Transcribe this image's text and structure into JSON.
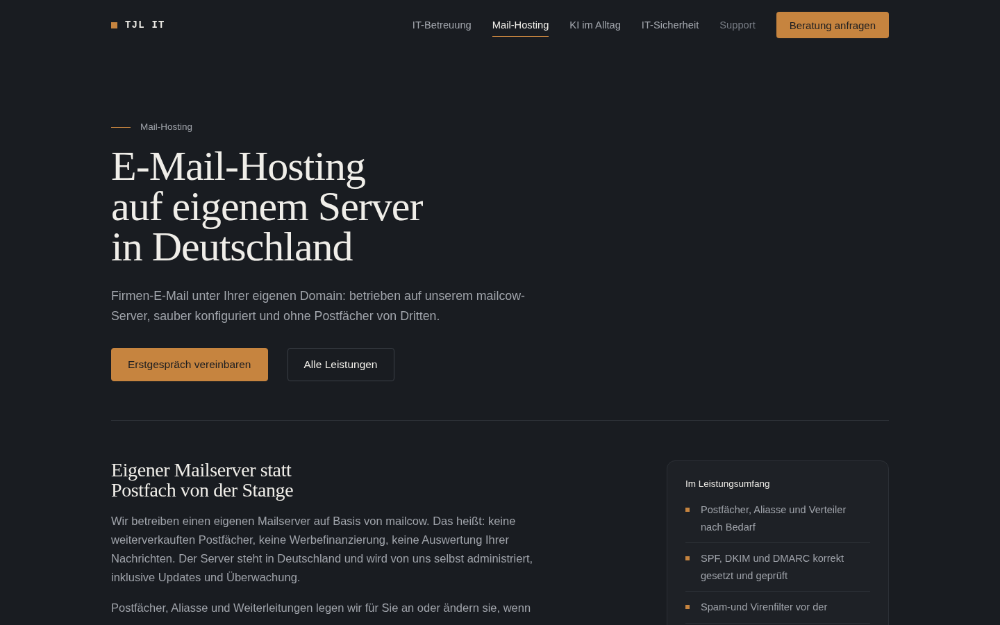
{
  "header": {
    "logo": "TJL IT",
    "nav": [
      {
        "label": "IT-Betreuung",
        "selected": false,
        "muted": false
      },
      {
        "label": "Mail-Hosting",
        "selected": true,
        "muted": false
      },
      {
        "label": "KI im Alltag",
        "selected": false,
        "muted": false
      },
      {
        "label": "IT-Sicherheit",
        "selected": false,
        "muted": false
      },
      {
        "label": "Support",
        "selected": false,
        "muted": true
      }
    ],
    "cta": "Beratung anfragen"
  },
  "hero": {
    "eyebrow": "Mail-Hosting",
    "title": [
      "E-Mail-Hosting",
      "auf eigenem Server",
      "in Deutschland"
    ],
    "lead": "Firmen-E-Mail unter Ihrer eigenen Domain: betrieben auf unserem mailcow-Server, sauber konfiguriert und ohne Postfächer von Dritten.",
    "buttons": [
      {
        "label": "Erstgespräch vereinbaren",
        "kind": "primary"
      },
      {
        "label": "Alle Leistungen",
        "kind": "secondary"
      }
    ]
  },
  "section": {
    "heading": [
      "Eigener Mailserver statt",
      "Postfach von der Stange"
    ],
    "paragraphs": [
      "Wir betreiben einen eigenen Mailserver auf Basis von mailcow. Das heißt: keine weiterverkauften Postfächer, keine Werbefinanzierung, keine Auswertung Ihrer Nachrichten. Der Server steht in Deutschland und wird von uns selbst administriert, inklusive Updates und Überwachung.",
      "Postfächer, Aliasse und Weiterleitungen legen wir für Sie an oder ändern sie, wenn"
    ],
    "card": {
      "title": "Im Leistungsumfang",
      "items": [
        "Postfächer, Aliasse und Verteiler nach Bedarf",
        "SPF, DKIM und DMARC korrekt gesetzt und geprüft",
        "Spam-und Virenfilter vor der"
      ]
    }
  }
}
